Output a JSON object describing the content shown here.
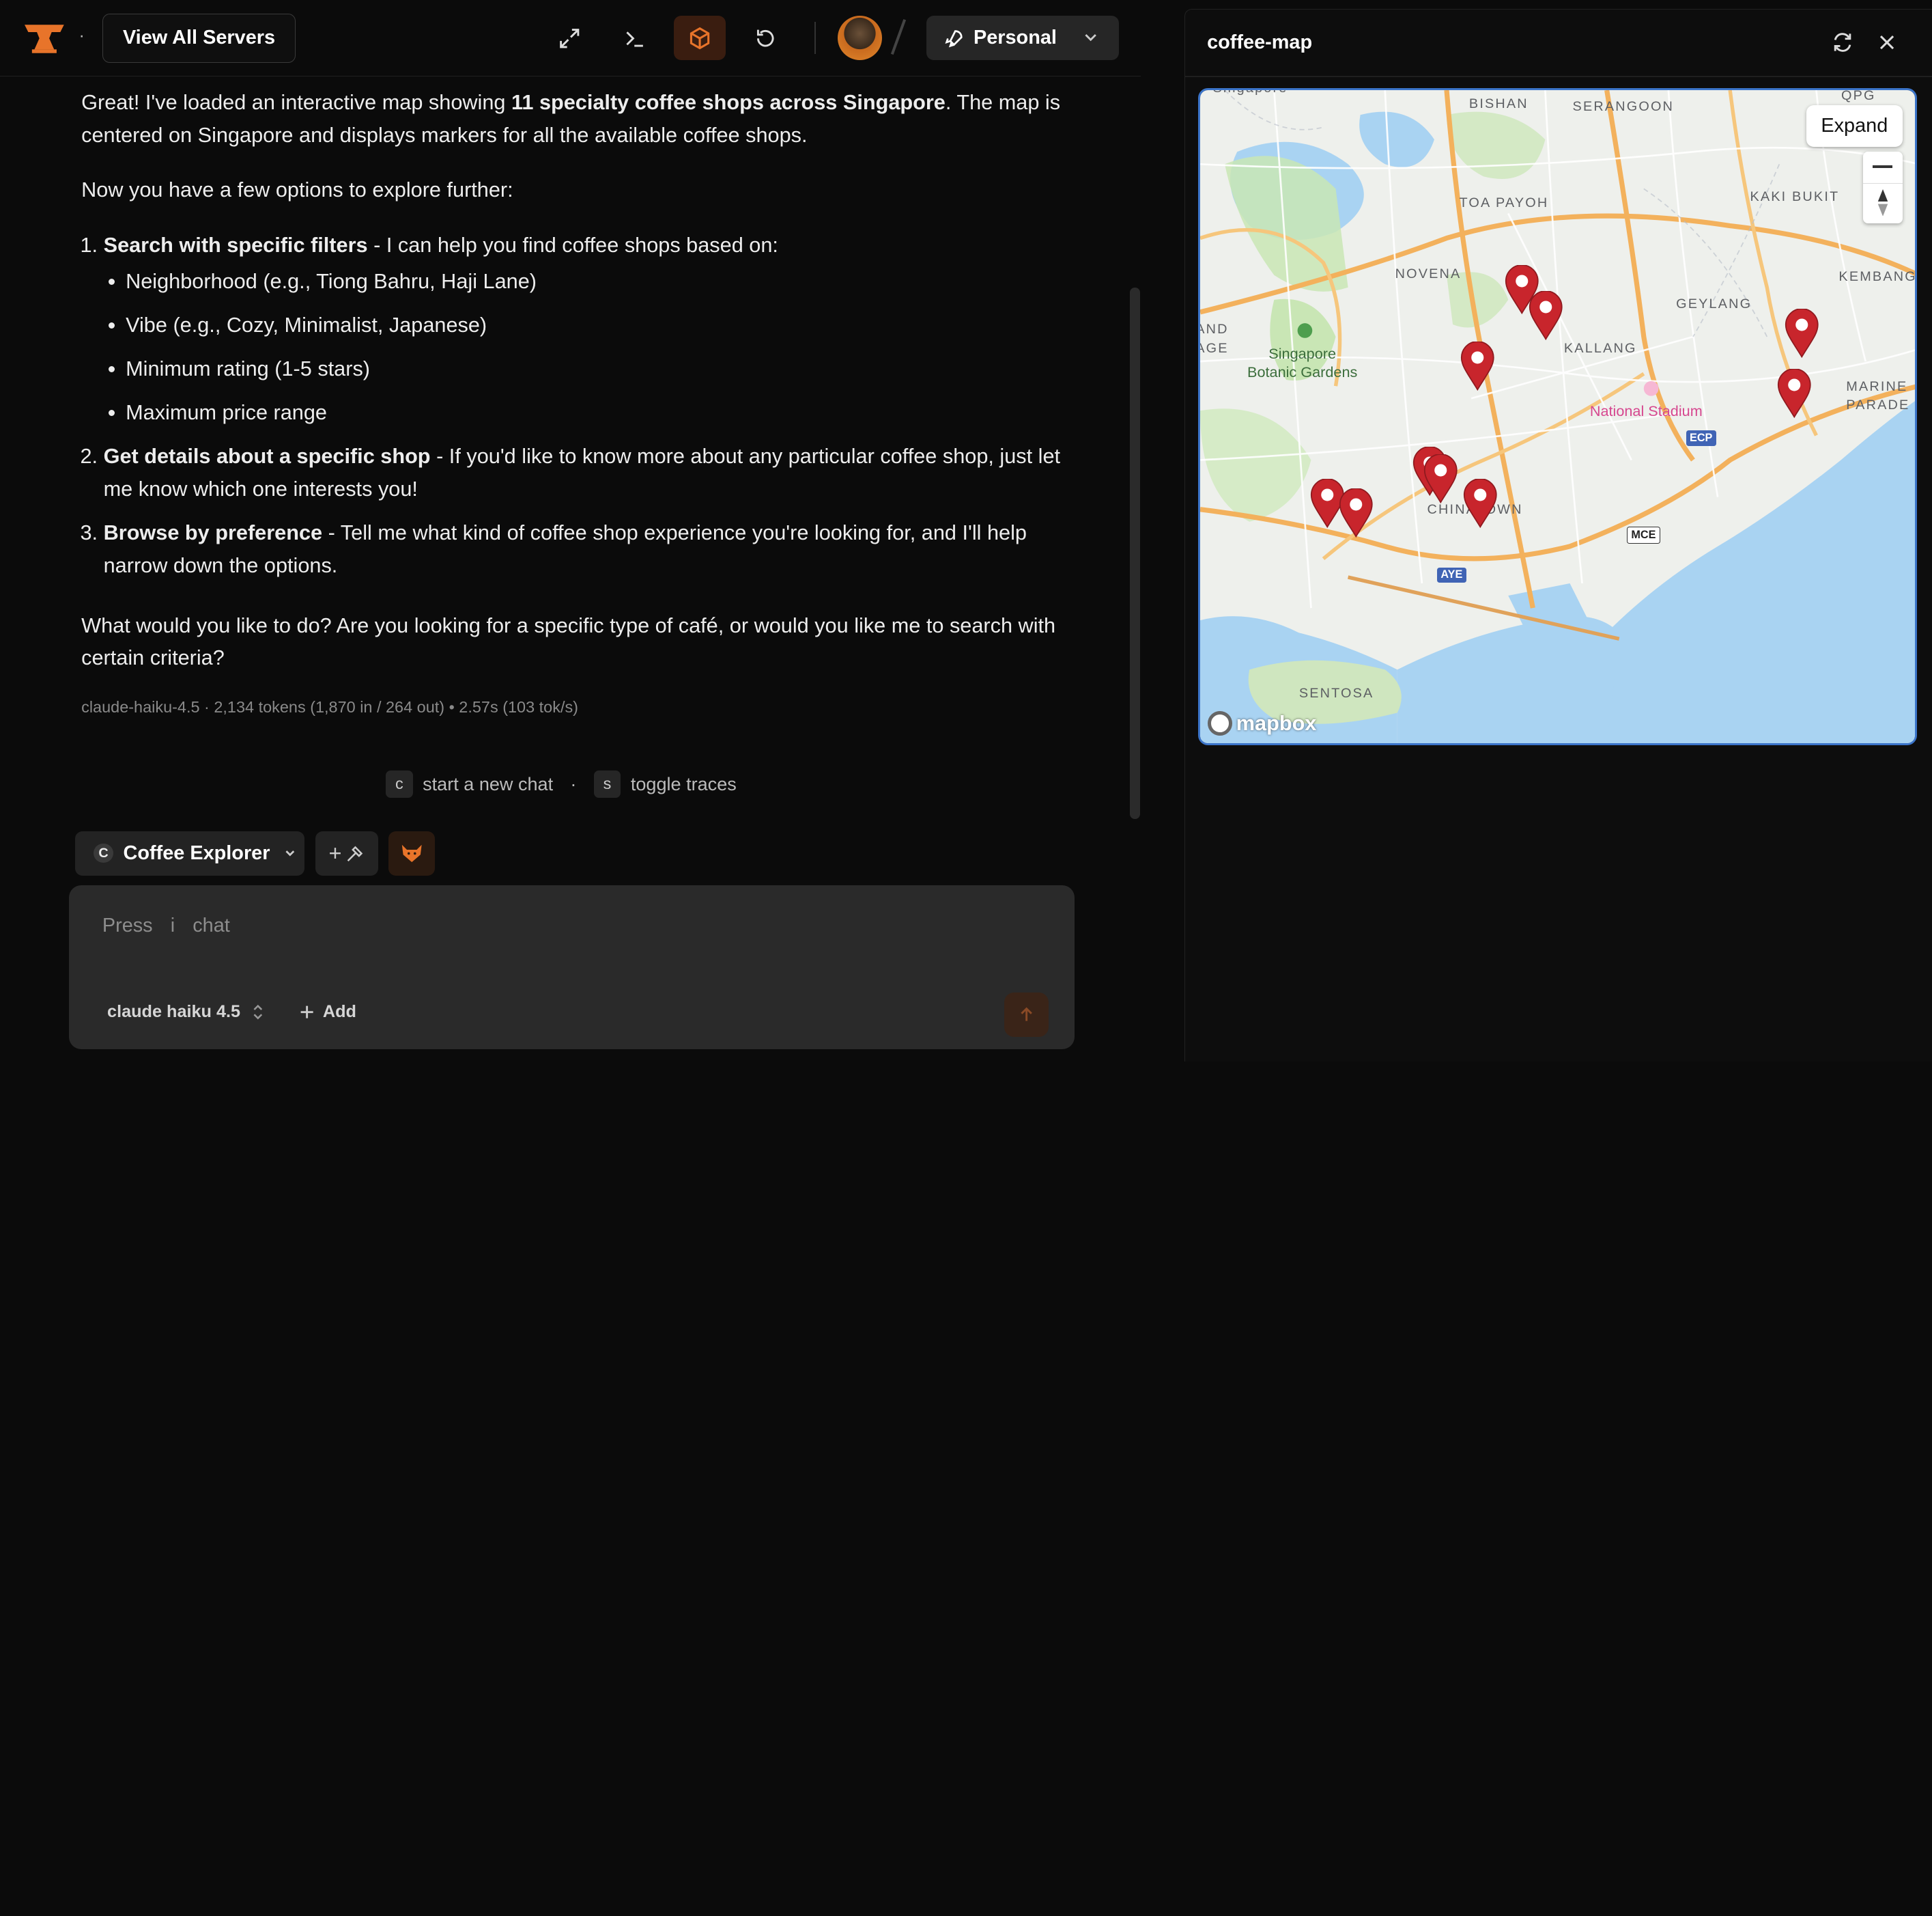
{
  "topbar": {
    "view_all_label": "View All Servers",
    "workspace_label": "Personal",
    "icons": [
      "maximize-icon",
      "terminal-icon",
      "box-icon",
      "refresh-icon"
    ]
  },
  "chat": {
    "intro_prefix": "Great! I've loaded an interactive map showing ",
    "intro_bold": "11 specialty coffee shops across Singapore",
    "intro_suffix": ". The map is centered on Singapore and displays markers for all the available coffee shops.",
    "options_lead": "Now you have a few options to explore further:",
    "options": [
      {
        "title": "Search with specific filters",
        "text": " - I can help you find coffee shops based on:",
        "bullets": [
          "Neighborhood (e.g., Tiong Bahru, Haji Lane)",
          "Vibe (e.g., Cozy, Minimalist, Japanese)",
          "Minimum rating (1-5 stars)",
          "Maximum price range"
        ]
      },
      {
        "title": "Get details about a specific shop",
        "text": " - If you'd like to know more about any particular coffee shop, just let me know which one interests you!"
      },
      {
        "title": "Browse by preference",
        "text": " - Tell me what kind of coffee shop experience you're looking for, and I'll help narrow down the options."
      }
    ],
    "closing": "What would you like to do? Are you looking for a specific type of café, or would you like me to search with certain criteria?",
    "meta": "claude-haiku-4.5 · 2,134 tokens (1,870 in / 264 out) • 2.57s (103 tok/s)"
  },
  "shortcuts": {
    "new_key": "c",
    "new_label": "start a new chat",
    "sep": "·",
    "trace_key": "s",
    "trace_label": "toggle traces"
  },
  "composer": {
    "agent_badge": "C",
    "agent_name": "Coffee Explorer",
    "tools_label": "+",
    "placeholder_press": "Press",
    "placeholder_key": "i",
    "placeholder_chat": "chat",
    "model": "claude haiku 4.5",
    "add_label": "Add"
  },
  "panel": {
    "title": "coffee-map",
    "expand_label": "Expand",
    "attribution": "mapbox",
    "labels": {
      "bishan": "BISHAN",
      "serangoon": "SERANGOON",
      "toa_payoh": "TOA PAYOH",
      "novena": "NOVENA",
      "geylang": "GEYLANG",
      "kallang": "KALLANG",
      "kembangan": "KEMBANGA",
      "kaki_bukit": "KAKI BUKIT",
      "marine": "MARINE",
      "parade": "PARADE",
      "botanic_1": "Singapore",
      "botanic_2": "Botanic Gardens",
      "stadium": "National Stadium",
      "chinatown": "CHINATOWN",
      "sentosa": "SENTOSA",
      "and": "AND",
      "age": "AGE",
      "qpg": "QPG",
      "singapore_top": "Singapore"
    },
    "roads": {
      "ecp": "ECP",
      "mce": "MCE",
      "aye": "AYE"
    },
    "marker_count": 11
  },
  "colors": {
    "accent": "#e8742a",
    "marker": "#c8252c",
    "water": "#a9d3f2",
    "land": "#eef0ec",
    "park": "#c9e6b5"
  }
}
